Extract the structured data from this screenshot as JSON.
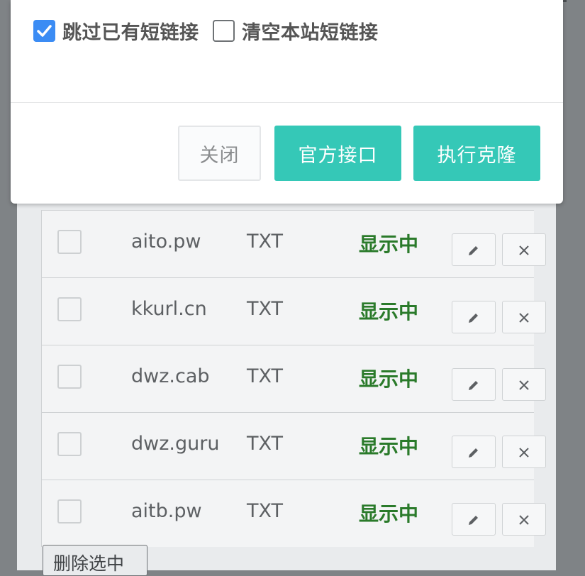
{
  "modal": {
    "options": [
      {
        "label": "跳过已有短链接",
        "checked": true
      },
      {
        "label": "清空本站短链接",
        "checked": false
      }
    ],
    "buttons": {
      "close": "关闭",
      "official_api": "官方接口",
      "execute_clone": "执行克隆"
    }
  },
  "table": {
    "rows": [
      {
        "domain": "aito.pw",
        "type": "TXT",
        "status": "显示中"
      },
      {
        "domain": "kkurl.cn",
        "type": "TXT",
        "status": "显示中"
      },
      {
        "domain": "dwz.cab",
        "type": "TXT",
        "status": "显示中"
      },
      {
        "domain": "dwz.guru",
        "type": "TXT",
        "status": "显示中"
      },
      {
        "domain": "aitb.pw",
        "type": "TXT",
        "status": "显示中"
      }
    ],
    "bulk_delete_label": "删除选中"
  },
  "colors": {
    "accent": "#35c8b7",
    "checkbox_checked": "#3b8cf4",
    "status_green": "#2a7a2a"
  }
}
